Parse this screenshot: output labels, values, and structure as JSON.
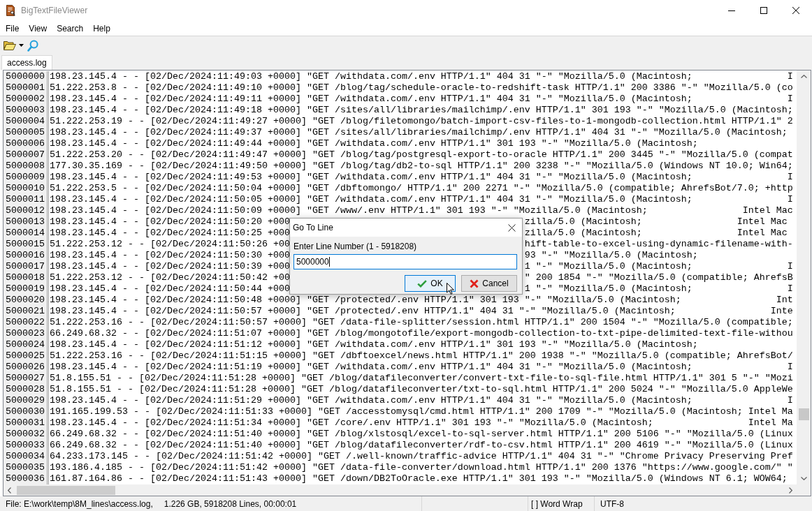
{
  "window": {
    "title": "BigTextFileViewer"
  },
  "menu": [
    "File",
    "View",
    "Search",
    "Help"
  ],
  "tabs": [
    {
      "label": "access.log",
      "selected": true
    }
  ],
  "lines": [
    {
      "number": "5000000",
      "text": "198.23.145.4 - - [02/Dec/2024:11:49:03 +0000] \"GET /withdata.com/.env HTTP/1.1\" 404 31 \"-\" \"Mozilla/5.0 (Macintosh;                 I"
    },
    {
      "number": "5000001",
      "text": "51.222.253.8 - - [02/Dec/2024:11:49:10 +0000] \"GET /blog/tag/schedule-oracle-to-redshift-task HTTP/1.1\" 200 3386 \"-\" \"Mozilla/5.0 (co"
    },
    {
      "number": "5000002",
      "text": "198.23.145.4 - - [02/Dec/2024:11:49:11 +0000] \"GET /withdata.com/.env HTTP/1.1\" 404 31 \"-\" \"Mozilla/5.0 (Macintosh;                 I"
    },
    {
      "number": "5000003",
      "text": "198.23.145.4 - - [02/Dec/2024:11:49:18 +0000] \"GET /sites/all/libraries/mailchimp/.env HTTP/1.1\" 301 193 \"-\" \"Mozilla/5.0 (Macintosh;"
    },
    {
      "number": "5000004",
      "text": "51.222.253.19 - - [02/Dec/2024:11:49:27 +0000] \"GET /blog/filetomongo/batch-import-csv-files-to-1-mongodb-collection.html HTTP/1.1\" 2"
    },
    {
      "number": "5000005",
      "text": "198.23.145.4 - - [02/Dec/2024:11:49:37 +0000] \"GET /sites/all/libraries/mailchimp/.env HTTP/1.1\" 404 31 \"-\" \"Mozilla/5.0 (Macintosh;"
    },
    {
      "number": "5000006",
      "text": "198.23.145.4 - - [02/Dec/2024:11:49:44 +0000] \"GET /withdata.com/.env HTTP/1.1\" 301 193 \"-\" \"Mozilla/5.0 (Macintosh;"
    },
    {
      "number": "5000007",
      "text": "51.222.253.20 - - [02/Dec/2024:11:49:47 +0000] \"GET /blog/tag/postgresql-export-to-oracle HTTP/1.1\" 200 3445 \"-\" \"Mozilla/5.0 (compat"
    },
    {
      "number": "5000008",
      "text": "177.30.35.169 - - [02/Dec/2024:11:49:50 +0000] \"GET /blog/tag/db2-to-sql HTTP/1.1\" 200 3238 \"-\" \"Mozilla/5.0 (Windows NT 10.0; Win64;"
    },
    {
      "number": "5000009",
      "text": "198.23.145.4 - - [02/Dec/2024:11:49:53 +0000] \"GET /withdata.com/.env HTTP/1.1\" 404 31 \"-\" \"Mozilla/5.0 (Macintosh;                 I"
    },
    {
      "number": "5000010",
      "text": "51.222.253.5 - - [02/Dec/2024:11:50:04 +0000] \"GET /dbftomongo/ HTTP/1.1\" 200 2271 \"-\" \"Mozilla/5.0 (compatible; AhrefsBot/7.0; +http"
    },
    {
      "number": "5000011",
      "text": "198.23.145.4 - - [02/Dec/2024:11:50:05 +0000] \"GET /withdata.com/.env HTTP/1.1\" 404 31 \"-\" \"Mozilla/5.0 (Macintosh;                 I"
    },
    {
      "number": "5000012",
      "text": "198.23.145.4 - - [02/Dec/2024:11:50:09 +0000] \"GET /www/.env HTTP/1.1\" 301 193 \"-\" \"Mozilla/5.0 (Macintosh;                 Intel Mac"
    },
    {
      "number": "5000013",
      "text": "198.23.145.4 - - [02/Dec/2024:11:50:20 +000",
      "text_after_dialog": "zilla/5.0 (Macintosh;                 Intel Mac"
    },
    {
      "number": "5000014",
      "text": "198.23.145.4 - - [02/Dec/2024:11:50:25 +000",
      "text_after_dialog": "zilla/5.0 (Macintosh;                 Intel Mac"
    },
    {
      "number": "5000015",
      "text": "51.222.253.12 - - [02/Dec/2024:11:50:26 +00",
      "text_after_dialog": "hift-table-to-excel-using-dynamic-filename-with-"
    },
    {
      "number": "5000016",
      "text": "198.23.145.4 - - [02/Dec/2024:11:50:30 +000",
      "text_after_dialog": "93 \"-\" \"Mozilla/5.0 (Macintosh;"
    },
    {
      "number": "5000017",
      "text": "198.23.145.4 - - [02/Dec/2024:11:50:39 +000",
      "text_after_dialog": "1 \"-\" \"Mozilla/5.0 (Macintosh;                 I"
    },
    {
      "number": "5000018",
      "text": "51.222.253.12 - - [02/Dec/2024:11:50:42 +00",
      "text_after_dialog": "\" 200 1854 \"-\" \"Mozilla/5.0 (compatible; AhrefsB"
    },
    {
      "number": "5000019",
      "text": "198.23.145.4 - - [02/Dec/2024:11:50:44 +000",
      "text_after_dialog": "1 \"-\" \"Mozilla/5.0 (Macintosh;                 I"
    },
    {
      "number": "5000020",
      "text": "198.23.145.4 - - [02/Dec/2024:11:50:48 +0000] \"GET /protected/.env HTTP/1.1\" 301 193 \"-\" \"Mozilla/5.0 (Macintosh;                 Int"
    },
    {
      "number": "5000021",
      "text": "198.23.145.4 - - [02/Dec/2024:11:50:57 +0000] \"GET /protected/.env HTTP/1.1\" 404 31 \"-\" \"Mozilla/5.0 (Macintosh;                 Inte"
    },
    {
      "number": "5000022",
      "text": "51.222.253.16 - - [02/Dec/2024:11:50:57 +0000] \"GET /data-file-splitter/session.html HTTP/1.1\" 200 1504 \"-\" \"Mozilla/5.0 (compatible;"
    },
    {
      "number": "5000023",
      "text": "66.249.68.32 - - [02/Dec/2024:11:51:07 +0000] \"GET /blog/mongotofile/export-mongodb-collection-to-txt-pipe-delimited-text-file-withou"
    },
    {
      "number": "5000024",
      "text": "198.23.145.4 - - [02/Dec/2024:11:51:12 +0000] \"GET /withdata.com/.env HTTP/1.1\" 301 193 \"-\" \"Mozilla/5.0 (Macintosh;"
    },
    {
      "number": "5000025",
      "text": "51.222.253.16 - - [02/Dec/2024:11:51:15 +0000] \"GET /dbftoexcel/news.html HTTP/1.1\" 200 1938 \"-\" \"Mozilla/5.0 (compatible; AhrefsBot/"
    },
    {
      "number": "5000026",
      "text": "198.23.145.4 - - [02/Dec/2024:11:51:19 +0000] \"GET /withdata.com/.env HTTP/1.1\" 404 31 \"-\" \"Mozilla/5.0 (Macintosh;                 I"
    },
    {
      "number": "5000027",
      "text": "51.8.155.51 - - [02/Dec/2024:11:51:28 +0000] \"GET /blog/datafileconverter/convert-txt-file-to-sql-file.html HTTP/1.1\" 301 5 \"-\" \"Mozi"
    },
    {
      "number": "5000028",
      "text": "51.8.155.51 - - [02/Dec/2024:11:51:28 +0000] \"GET /blog/datafileconverter/txt-to-sql.html HTTP/1.1\" 200 5024 \"-\" \"Mozilla/5.0 AppleWe"
    },
    {
      "number": "5000029",
      "text": "198.23.145.4 - - [02/Dec/2024:11:51:29 +0000] \"GET /withdata.com/.env HTTP/1.1\" 404 31 \"-\" \"Mozilla/5.0 (Macintosh;                 I"
    },
    {
      "number": "5000030",
      "text": "191.165.199.53 - - [02/Dec/2024:11:51:33 +0000] \"GET /accesstomysql/cmd.html HTTP/1.1\" 200 1709 \"-\" \"Mozilla/5.0 (Macintosh; Intel Ma"
    },
    {
      "number": "5000031",
      "text": "198.23.145.4 - - [02/Dec/2024:11:51:34 +0000] \"GET /core/.env HTTP/1.1\" 301 193 \"-\" \"Mozilla/5.0 (Macintosh;                 Intel Ma"
    },
    {
      "number": "5000032",
      "text": "66.249.68.32 - - [02/Dec/2024:11:51:40 +0000] \"GET /blog/xlstosql/excel-to-sql-server.html HTTP/1.1\" 200 5106 \"-\" \"Mozilla/5.0 (Linux"
    },
    {
      "number": "5000033",
      "text": "66.249.68.32 - - [02/Dec/2024:11:51:40 +0000] \"GET /blog/datafileconverter/rdf-to-csv.html HTTP/1.1\" 200 4619 \"-\" \"Mozilla/5.0 (Linux"
    },
    {
      "number": "5000034",
      "text": "64.233.173.145 - - [02/Dec/2024:11:51:42 +0000] \"GET /.well-known/traffic-advice HTTP/1.1\" 404 31 \"-\" \"Chrome Privacy Preserving Pref"
    },
    {
      "number": "5000035",
      "text": "193.186.4.185 - - [02/Dec/2024:11:51:42 +0000] \"GET /data-file-converter/download.html HTTP/1.1\" 200 1376 \"https://www.google.com/\" \""
    },
    {
      "number": "5000036",
      "text": "161.87.164.86 - - [02/Dec/2024:11:51:43 +0000] \"GET /down/DB2ToOracle.exe HTTP/1.1\" 301 193 \"-\" \"Mozilla/5.0 (Windows NT 6.1; WOW64;"
    }
  ],
  "dialog": {
    "title": "Go To Line",
    "label": "Enter Line Number (1 - 5918208)",
    "input": {
      "value": "5000000",
      "focused": true
    },
    "buttons": [
      {
        "label": "OK",
        "kind": "ok",
        "focused": true
      },
      {
        "label": "Cancel",
        "kind": "cancel",
        "focused": false
      }
    ]
  },
  "status_bar": {
    "file": "File: E:\\work\\temp\\8M_lines\\access.log,",
    "info": "1.226 GB, 5918208 Lines, 00:00:01",
    "word_wrap": "[ ] Word Wrap",
    "encoding": "UTF-8"
  }
}
